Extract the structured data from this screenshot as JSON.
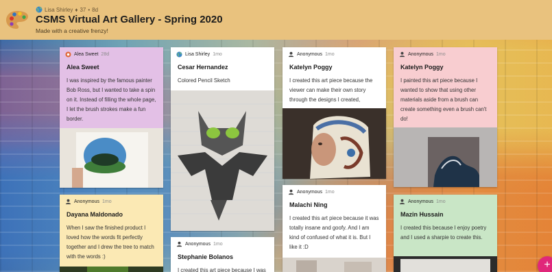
{
  "header": {
    "author": "Lisa Shirley",
    "score": "37",
    "age": "8d",
    "separator": "•",
    "diamond": "♦",
    "title": "CSMS Virtual Art Gallery - Spring 2020",
    "subtitle": "Made with a creative frenzy!"
  },
  "posts": [
    {
      "author": "Alea Sweet",
      "time": "28d",
      "title": "Alea Sweet",
      "body": "I was inspired by the famous painter Bob Ross, but I wanted to take a spin on it. Instead of filling the whole page, I let the brush strokes make a fun border.",
      "color": "#e3c0e6"
    },
    {
      "author": "Anonymous",
      "time": "1mo",
      "title": "Dayana Maldonado",
      "body": "When I saw the finished product I loved how the words fit perfectly together and I drew the tree to match with the words :)",
      "color": "#fbe9b4"
    },
    {
      "author": "Lisa Shirley",
      "time": "1mo",
      "title": "Cesar Hernandez",
      "body": "Colored Pencil Sketch",
      "color": "#ffffff"
    },
    {
      "author": "Anonymous",
      "time": "1mo",
      "title": "Stephanie Bolanos",
      "body": "I created this art piece because I was",
      "color": "#ffffff"
    },
    {
      "author": "Anonymous",
      "time": "1mo",
      "title": "Katelyn Poggy",
      "body": "I created this art piece because the viewer can make their own story through the designs I created,",
      "color": "#ffffff"
    },
    {
      "author": "Anonymous",
      "time": "1mo",
      "title": "Malachi Ning",
      "body": "I created this art piece because it was totally insane and goofy. And I am kind of confused of what it is. But I like it :D",
      "color": "#ffffff"
    },
    {
      "author": "Anonymous",
      "time": "1mo",
      "title": "Katelyn Poggy",
      "body": "I painted this art piece because I wanted to show that using other materials aside from a brush can create something even a brush can't do!",
      "color": "#f8cdd0"
    },
    {
      "author": "Anonymous",
      "time": "1mo",
      "title": "Mazin Hussain",
      "body": "I created this because I enjoy poetry and I used a sharpie to create this.",
      "color": "#c9e6c6"
    }
  ],
  "fab": {
    "label": "+"
  }
}
